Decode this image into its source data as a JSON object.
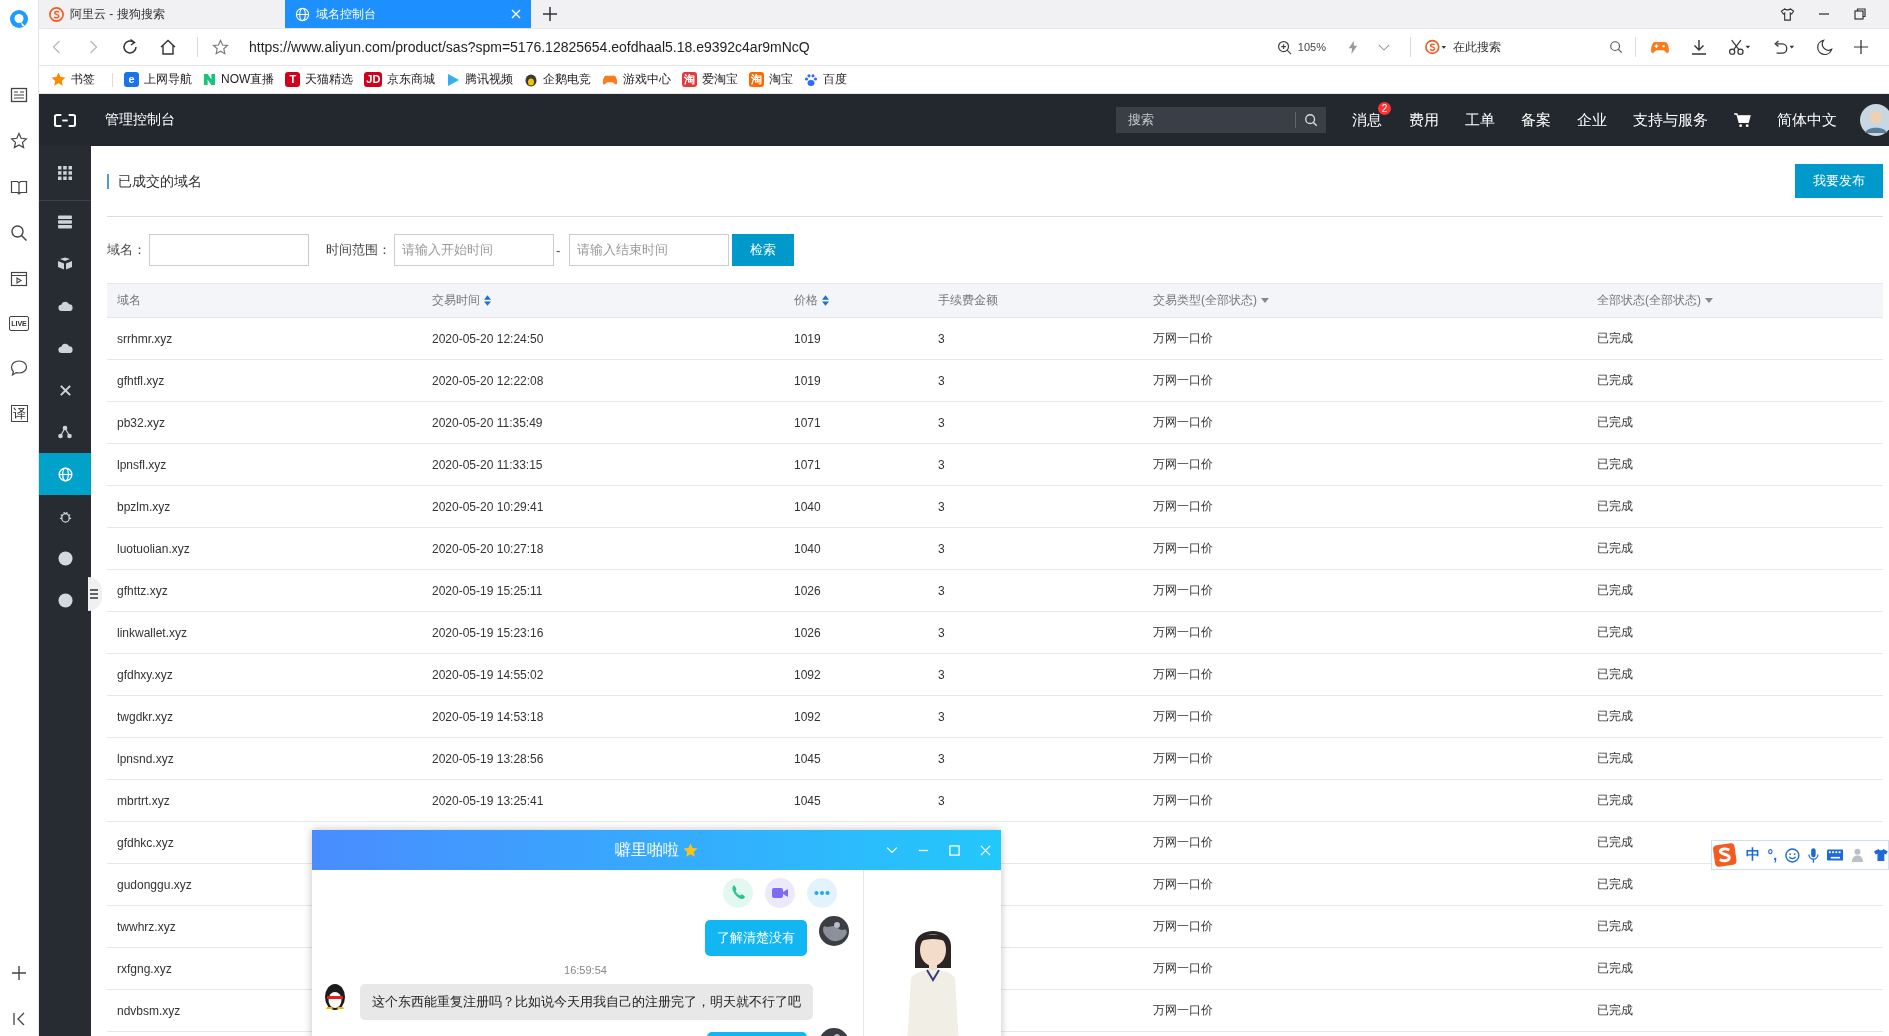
{
  "browser_sidebar": {
    "live_label": "LIVE",
    "translate_label": "译"
  },
  "tabs": [
    {
      "label": "阿里云 - 搜狗搜索",
      "selected": false
    },
    {
      "label": "域名控制台",
      "selected": true
    }
  ],
  "address_bar": {
    "url": "https://www.aliyun.com/product/sas?spm=5176.12825654.eofdhaal5.18.e9392c4ar9mNcQ",
    "zoom": "105%",
    "search_placeholder": "在此搜索"
  },
  "bookmarks": [
    {
      "label": "书签",
      "kind": "star",
      "color": "#ff8a00"
    },
    {
      "label": "上网导航",
      "kind": "glyph",
      "glyph": "e",
      "color": "#1a73e8"
    },
    {
      "label": "NOW直播",
      "kind": "now",
      "color": "#19c37d"
    },
    {
      "label": "天猫精选",
      "kind": "glyph",
      "glyph": "T",
      "color": "#d0021b"
    },
    {
      "label": "京东商城",
      "kind": "glyph",
      "glyph": "JD",
      "color": "#d0021b"
    },
    {
      "label": "腾讯视频",
      "kind": "play",
      "color": "#2fb0f0"
    },
    {
      "label": "企鹅电竞",
      "kind": "penguin",
      "color": "#3a3a3a"
    },
    {
      "label": "游戏中心",
      "kind": "gamepad",
      "color": "#ff7a1a"
    },
    {
      "label": "爱淘宝",
      "kind": "glyph",
      "glyph": "淘",
      "color": "#e4393c"
    },
    {
      "label": "淘宝",
      "kind": "glyph",
      "glyph": "淘",
      "color": "#ff6a00"
    },
    {
      "label": "百度",
      "kind": "paw",
      "color": "#2e6bff"
    }
  ],
  "console": {
    "title": "管理控制台",
    "search_placeholder": "搜索",
    "nav": [
      {
        "kind": "text",
        "label": "消息",
        "badge": "2"
      },
      {
        "kind": "text",
        "label": "费用"
      },
      {
        "kind": "text",
        "label": "工单"
      },
      {
        "kind": "text",
        "label": "备案"
      },
      {
        "kind": "text",
        "label": "企业"
      },
      {
        "kind": "text",
        "label": "支持与服务"
      },
      {
        "kind": "cart"
      },
      {
        "kind": "text",
        "label": "简体中文"
      }
    ]
  },
  "sidebar": {
    "items": [
      {
        "kind": "grid",
        "selected": false
      },
      {
        "kind": "server",
        "selected": false
      },
      {
        "kind": "cluster",
        "selected": false
      },
      {
        "kind": "cloud",
        "selected": false
      },
      {
        "kind": "cloud",
        "selected": false
      },
      {
        "kind": "cross",
        "selected": false
      },
      {
        "kind": "nodes",
        "selected": false
      },
      {
        "kind": "globe",
        "selected": true
      },
      {
        "kind": "bug",
        "selected": false
      },
      {
        "kind": "dot",
        "selected": false
      },
      {
        "kind": "dot",
        "selected": false
      }
    ]
  },
  "page": {
    "title": "已成交的域名",
    "publish_button": "我要发布"
  },
  "filter": {
    "domain_label": "域名：",
    "time_label": "时间范围：",
    "start_placeholder": "请输入开始时间",
    "separator": "-",
    "end_placeholder": "请输入结束时间",
    "search_button": "检索"
  },
  "table": {
    "columns": [
      {
        "label": "域名"
      },
      {
        "label": "交易时间",
        "kind": "sort"
      },
      {
        "label": "价格",
        "kind": "sort"
      },
      {
        "label": "手续费金额"
      },
      {
        "label": "交易类型(全部状态)",
        "kind": "dropdown"
      },
      {
        "label": "全部状态(全部状态)",
        "kind": "dropdown"
      }
    ],
    "rows": [
      {
        "domain": "srrhmr.xyz",
        "time": "2020-05-20 12:24:50",
        "price": "1019",
        "fee": "3",
        "type": "万网一口价",
        "status": "已完成"
      },
      {
        "domain": "gfhtfl.xyz",
        "time": "2020-05-20 12:22:08",
        "price": "1019",
        "fee": "3",
        "type": "万网一口价",
        "status": "已完成"
      },
      {
        "domain": "pb32.xyz",
        "time": "2020-05-20 11:35:49",
        "price": "1071",
        "fee": "3",
        "type": "万网一口价",
        "status": "已完成"
      },
      {
        "domain": "lpnsfl.xyz",
        "time": "2020-05-20 11:33:15",
        "price": "1071",
        "fee": "3",
        "type": "万网一口价",
        "status": "已完成"
      },
      {
        "domain": "bpzlm.xyz",
        "time": "2020-05-20 10:29:41",
        "price": "1040",
        "fee": "3",
        "type": "万网一口价",
        "status": "已完成"
      },
      {
        "domain": "luotuolian.xyz",
        "time": "2020-05-20 10:27:18",
        "price": "1040",
        "fee": "3",
        "type": "万网一口价",
        "status": "已完成"
      },
      {
        "domain": "gfhttz.xyz",
        "time": "2020-05-19 15:25:11",
        "price": "1026",
        "fee": "3",
        "type": "万网一口价",
        "status": "已完成"
      },
      {
        "domain": "linkwallet.xyz",
        "time": "2020-05-19 15:23:16",
        "price": "1026",
        "fee": "3",
        "type": "万网一口价",
        "status": "已完成"
      },
      {
        "domain": "gfdhxy.xyz",
        "time": "2020-05-19 14:55:02",
        "price": "1092",
        "fee": "3",
        "type": "万网一口价",
        "status": "已完成"
      },
      {
        "domain": "twgdkr.xyz",
        "time": "2020-05-19 14:53:18",
        "price": "1092",
        "fee": "3",
        "type": "万网一口价",
        "status": "已完成"
      },
      {
        "domain": "lpnsnd.xyz",
        "time": "2020-05-19 13:28:56",
        "price": "1045",
        "fee": "3",
        "type": "万网一口价",
        "status": "已完成"
      },
      {
        "domain": "mbrtrt.xyz",
        "time": "2020-05-19 13:25:41",
        "price": "1045",
        "fee": "3",
        "type": "万网一口价",
        "status": "已完成"
      },
      {
        "domain": "gfdhkc.xyz",
        "type": "万网一口价",
        "status": "已完成"
      },
      {
        "domain": "gudonggu.xyz",
        "type": "万网一口价",
        "status": "已完成"
      },
      {
        "domain": "twwhrz.xyz",
        "type": "万网一口价",
        "status": "已完成"
      },
      {
        "domain": "rxfgng.xyz",
        "type": "万网一口价",
        "status": "已完成"
      },
      {
        "domain": "ndvbsm.xyz",
        "type": "万网一口价",
        "status": "已完成"
      }
    ]
  },
  "chat": {
    "title": "噼里啪啦",
    "messages": [
      {
        "kind": "outgoing",
        "text": "了解清楚没有"
      },
      {
        "kind": "time",
        "text": "16:59:54"
      },
      {
        "kind": "incoming",
        "text": "这个东西能重复注册吗？比如说今天用我自己的注册完了，明天就不行了吧"
      },
      {
        "kind": "outgoing"
      }
    ]
  },
  "ime_toolbar": {
    "mode": "中",
    "punctuation": "°,"
  }
}
